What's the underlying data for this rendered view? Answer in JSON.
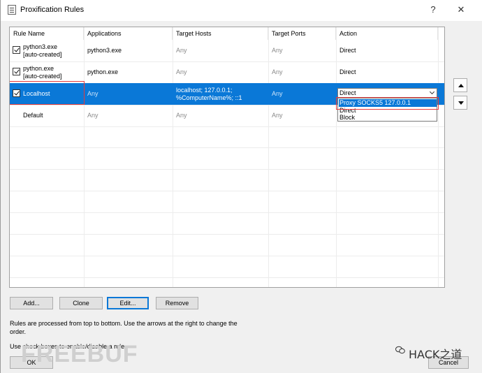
{
  "window": {
    "title": "Proxification Rules",
    "help_btn": "?",
    "close_btn": "✕"
  },
  "table": {
    "columns": [
      "Rule Name",
      "Applications",
      "Target Hosts",
      "Target Ports",
      "Action"
    ],
    "rows": [
      {
        "name": "python3.exe\n[auto-created]",
        "app": "python3.exe",
        "hosts": "Any",
        "ports": "Any",
        "action": "Direct",
        "checked": true
      },
      {
        "name": "python.exe\n[auto-created]",
        "app": "python.exe",
        "hosts": "Any",
        "ports": "Any",
        "action": "Direct",
        "checked": true
      },
      {
        "name": "Localhost",
        "app": "Any",
        "hosts": "localhost; 127.0.0.1;\n%ComputerName%; ::1",
        "ports": "Any",
        "action": "Direct",
        "checked": true
      },
      {
        "name": "Default",
        "app": "Any",
        "hosts": "Any",
        "ports": "Any",
        "action": "",
        "checked": false
      }
    ]
  },
  "action_dropdown": {
    "selected": "Direct",
    "options": [
      "Proxy SOCKS5 127.0.0.1",
      "Direct",
      "Block"
    ]
  },
  "buttons": {
    "add": "Add...",
    "clone": "Clone",
    "edit": "Edit...",
    "remove": "Remove",
    "ok": "OK",
    "cancel": "Cancel"
  },
  "notes": {
    "order": "Rules are processed from top to bottom. Use the arrows at the right to change the\norder.",
    "checkbox": "Use check boxes to enable/disable a rule."
  },
  "watermarks": {
    "left": "FREEBUF",
    "right": "HACK之道"
  },
  "colors": {
    "selection": "#0a78d7",
    "highlight_box": "#e53b3b"
  }
}
